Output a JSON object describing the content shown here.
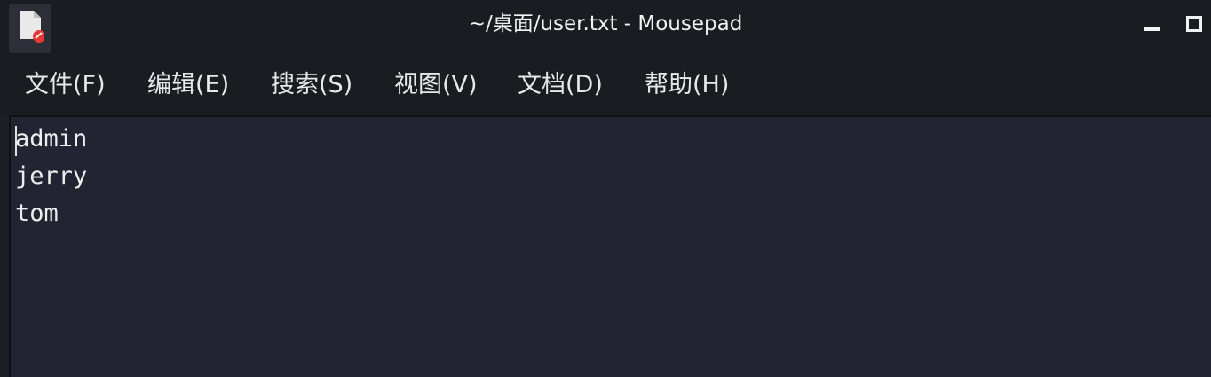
{
  "window": {
    "title": "~/桌面/user.txt - Mousepad",
    "app_icon": "text-document-icon"
  },
  "colors": {
    "titlebar_bg": "#1a1c22",
    "editor_bg": "#222531",
    "text": "#eeeeee",
    "icon_badge": "#e53935"
  },
  "menu": {
    "items": [
      {
        "label": "文件(F)"
      },
      {
        "label": "编辑(E)"
      },
      {
        "label": "搜索(S)"
      },
      {
        "label": "视图(V)"
      },
      {
        "label": "文档(D)"
      },
      {
        "label": "帮助(H)"
      }
    ]
  },
  "editor": {
    "lines": [
      "admin",
      "jerry",
      "tom"
    ]
  }
}
